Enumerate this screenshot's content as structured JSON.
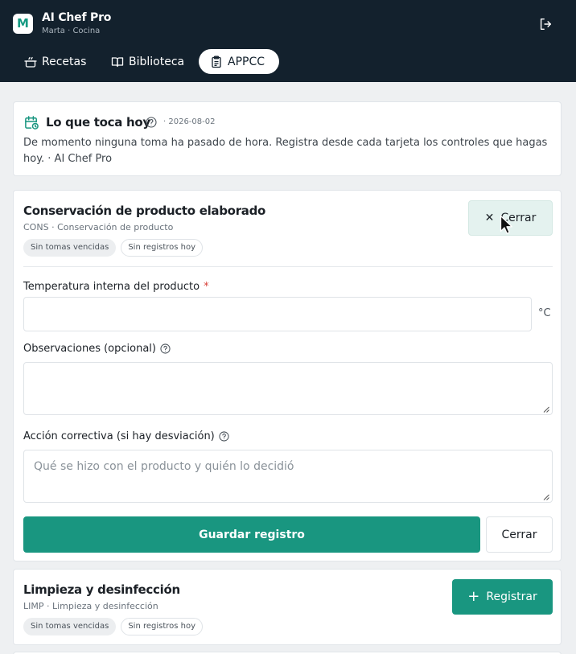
{
  "app": {
    "logo_letter": "M",
    "title": "AI Chef Pro",
    "subtitle": "Marta · Cocina"
  },
  "nav": [
    {
      "label": "Recetas",
      "icon": "pot-icon",
      "active": false
    },
    {
      "label": "Biblioteca",
      "icon": "book-icon",
      "active": false
    },
    {
      "label": "APPCC",
      "icon": "clipboard-icon",
      "active": true
    }
  ],
  "today": {
    "title": "Lo que toca hoy",
    "date": "· 2026-08-02",
    "message": "De momento ninguna toma ha pasado de hora. Registra desde cada tarjeta los controles que hagas hoy. · AI Chef Pro"
  },
  "controls": [
    {
      "title": "Conservación de producto elaborado",
      "code": "CONS",
      "category": "Conservación de producto",
      "chips": [
        "Sin tomas vencidas",
        "Sin registros hoy"
      ],
      "close_label": "Cerrar",
      "form": {
        "temp_label": "Temperatura interna del producto",
        "required_mark": "*",
        "temp_value": "",
        "temp_unit": "°C",
        "obs_label": "Observaciones (opcional)",
        "obs_value": "",
        "action_label": "Acción correctiva (si hay desviación)",
        "action_placeholder": "Qué se hizo con el producto y quién lo decidió",
        "save_label": "Guardar registro",
        "close_label": "Cerrar"
      }
    },
    {
      "title": "Limpieza y desinfección",
      "code": "LIMP",
      "category": "Limpieza y desinfección",
      "chips": [
        "Sin tomas vencidas",
        "Sin registros hoy"
      ],
      "register_label": "Registrar"
    }
  ],
  "colors": {
    "header_bg": "#13212d",
    "accent": "#199680",
    "close_button_bg": "#e4f2ef",
    "required": "#d8413a"
  }
}
